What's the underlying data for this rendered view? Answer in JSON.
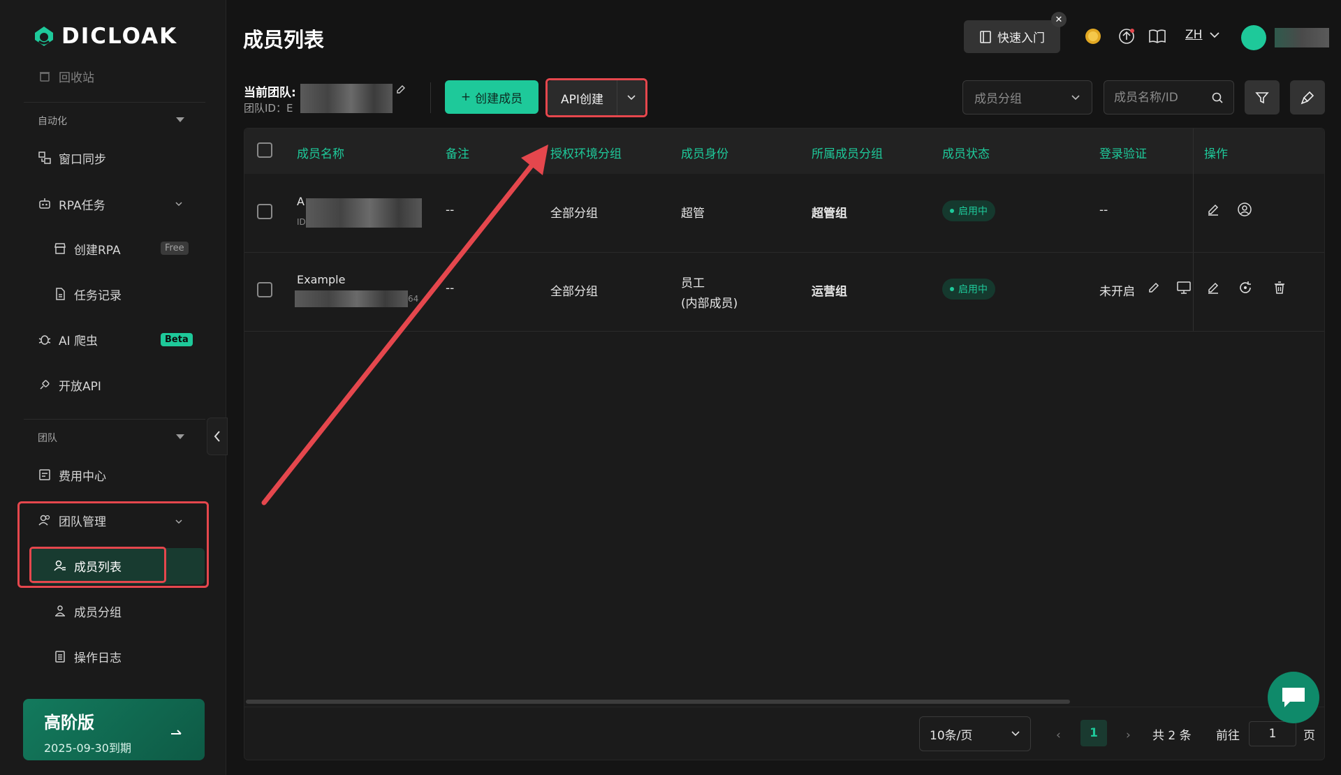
{
  "app": {
    "logo_text": "DICLOAK"
  },
  "sidebar": {
    "partial_item": "回收站",
    "automation_section": "自动化",
    "items_automation": [
      {
        "label": "窗口同步",
        "icon": "window-sync-icon"
      },
      {
        "label": "RPA任务",
        "icon": "robot-icon"
      }
    ],
    "rpa_sub": [
      {
        "label": "创建RPA",
        "icon": "shop-icon",
        "badge": "Free"
      },
      {
        "label": "任务记录",
        "icon": "document-icon"
      }
    ],
    "ai_crawler": {
      "label": "AI 爬虫",
      "icon": "bug-icon",
      "badge": "Beta"
    },
    "open_api": {
      "label": "开放API",
      "icon": "plug-icon"
    },
    "team_section": "团队",
    "billing": {
      "label": "费用中心",
      "icon": "billing-icon"
    },
    "team_mgmt": {
      "label": "团队管理",
      "icon": "users-icon"
    },
    "team_sub": [
      {
        "label": "成员列表",
        "icon": "user-list-icon",
        "active": true
      },
      {
        "label": "成员分组",
        "icon": "user-group-icon"
      },
      {
        "label": "操作日志",
        "icon": "clipboard-icon"
      }
    ],
    "plan": {
      "name": "高阶版",
      "expiry": "2025-09-30到期"
    }
  },
  "header": {
    "title": "成员列表",
    "quick_start": "快速入门",
    "close_glyph": "✕",
    "language": "ZH"
  },
  "toolbar": {
    "team_label": "当前团队:",
    "team_id_label": "团队ID：E",
    "create_member": "创建成员",
    "create_plus": "+",
    "api_create": "API创建",
    "group_select_placeholder": "成员分组",
    "search_placeholder": "成员名称/ID"
  },
  "table": {
    "columns": [
      "成员名称",
      "备注",
      "授权环境分组",
      "成员身份",
      "所属成员分组",
      "成员状态",
      "登录验证",
      "操作"
    ],
    "rows": [
      {
        "name": "A",
        "id_prefix": "ID",
        "remark": "--",
        "env_group": "全部分组",
        "role": "超管",
        "role_sub": "",
        "member_group": "超管组",
        "status": "启用中",
        "login_verify": "--"
      },
      {
        "name": "Example",
        "id_suffix": "64",
        "remark": "--",
        "env_group": "全部分组",
        "role": "员工",
        "role_sub": "(内部成员)",
        "member_group": "运营组",
        "status": "启用中",
        "login_verify": "未开启"
      }
    ]
  },
  "pagination": {
    "page_size": "10条/页",
    "current_page": "1",
    "total": "共 2 条",
    "goto_label": "前往",
    "goto_value": "1",
    "page_unit": "页",
    "prev": "‹",
    "next": "›"
  },
  "colors": {
    "accent": "#1ec99a",
    "highlight": "#e5474d",
    "background": "#141414"
  }
}
